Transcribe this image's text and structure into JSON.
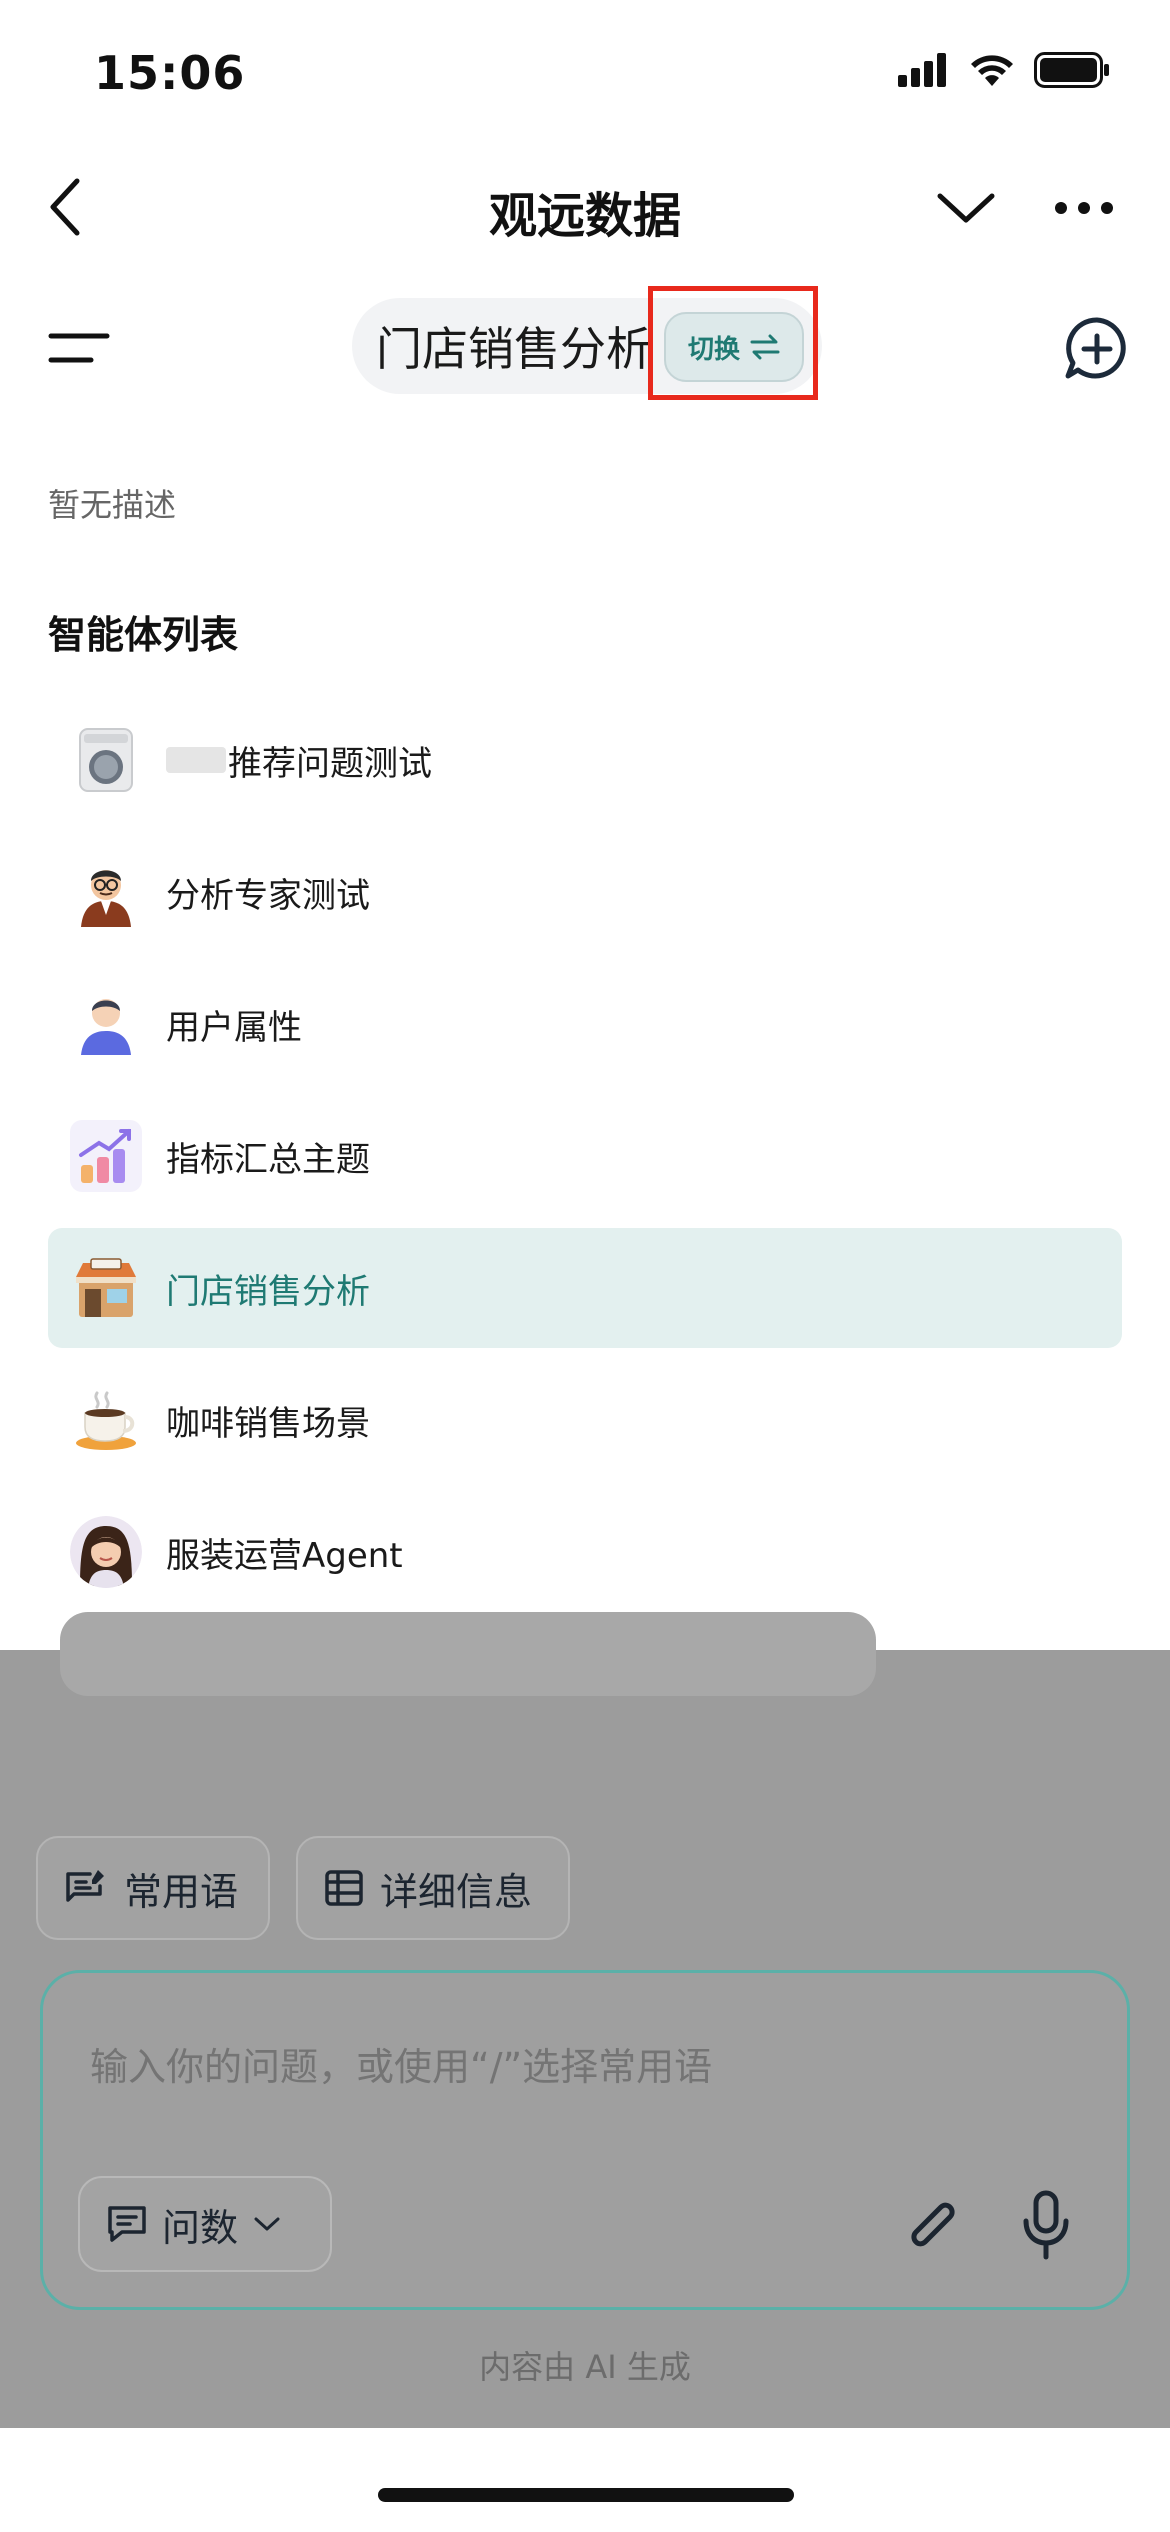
{
  "status_bar": {
    "time": "15:06"
  },
  "nav": {
    "title": "观远数据"
  },
  "agent_header": {
    "name": "门店销售分析",
    "switch_label": "切换"
  },
  "description": "暂无描述",
  "section_title": "智能体列表",
  "agents": [
    {
      "label": "推荐问题测试",
      "icon": "washing-machine-icon"
    },
    {
      "label": "分析专家测试",
      "icon": "expert-avatar-icon"
    },
    {
      "label": "用户属性",
      "icon": "user-avatar-icon"
    },
    {
      "label": "指标汇总主题",
      "icon": "chart-growth-icon"
    },
    {
      "label": "门店销售分析",
      "icon": "shop-icon",
      "active": true
    },
    {
      "label": "咖啡销售场景",
      "icon": "coffee-cup-icon"
    },
    {
      "label": "服装运营Agent",
      "icon": "woman-avatar-icon"
    }
  ],
  "toolbar": {
    "phrases_label": "常用语",
    "details_label": "详细信息"
  },
  "input": {
    "placeholder": "输入你的问题，或使用“/”选择常用语",
    "mode": "问数"
  },
  "footer_note": "内容由 AI 生成",
  "colors": {
    "accent": "#1f7a73",
    "highlight": "#e8291c",
    "active_bg": "#e3f0ef"
  }
}
